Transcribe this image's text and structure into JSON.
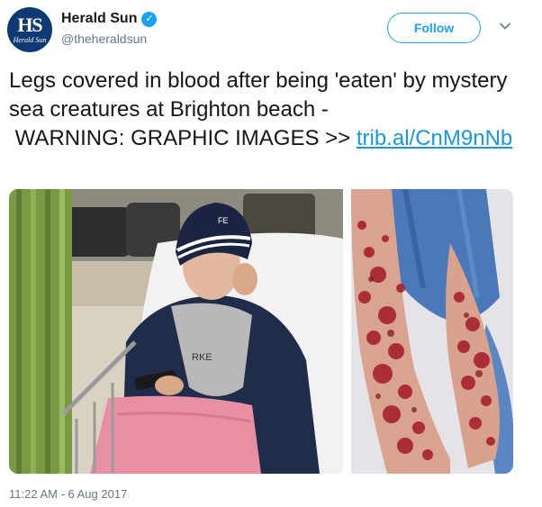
{
  "account": {
    "display_name": "Herald Sun",
    "handle": "@theheraldsun",
    "avatar_monogram": "HS",
    "avatar_subtext": "Herald Sun",
    "verified_icon": "verified-badge-icon"
  },
  "actions": {
    "follow_label": "Follow",
    "menu_icon": "chevron-down-icon"
  },
  "tweet": {
    "text": "Legs covered in blood after being 'eaten' by mystery sea creatures at Brighton beach -\n WARNING: GRAPHIC IMAGES >> ",
    "link_text": "trib.al/CnM9nNb",
    "beanie_text": "FE",
    "hoodie_text": "RKE",
    "timestamp": "11:22 AM - 6 Aug 2017"
  },
  "colors": {
    "brand_blue": "#1da1f2",
    "link_blue": "#1b95e0",
    "muted_text": "#657786",
    "avatar_bg": "#0e3a73"
  }
}
